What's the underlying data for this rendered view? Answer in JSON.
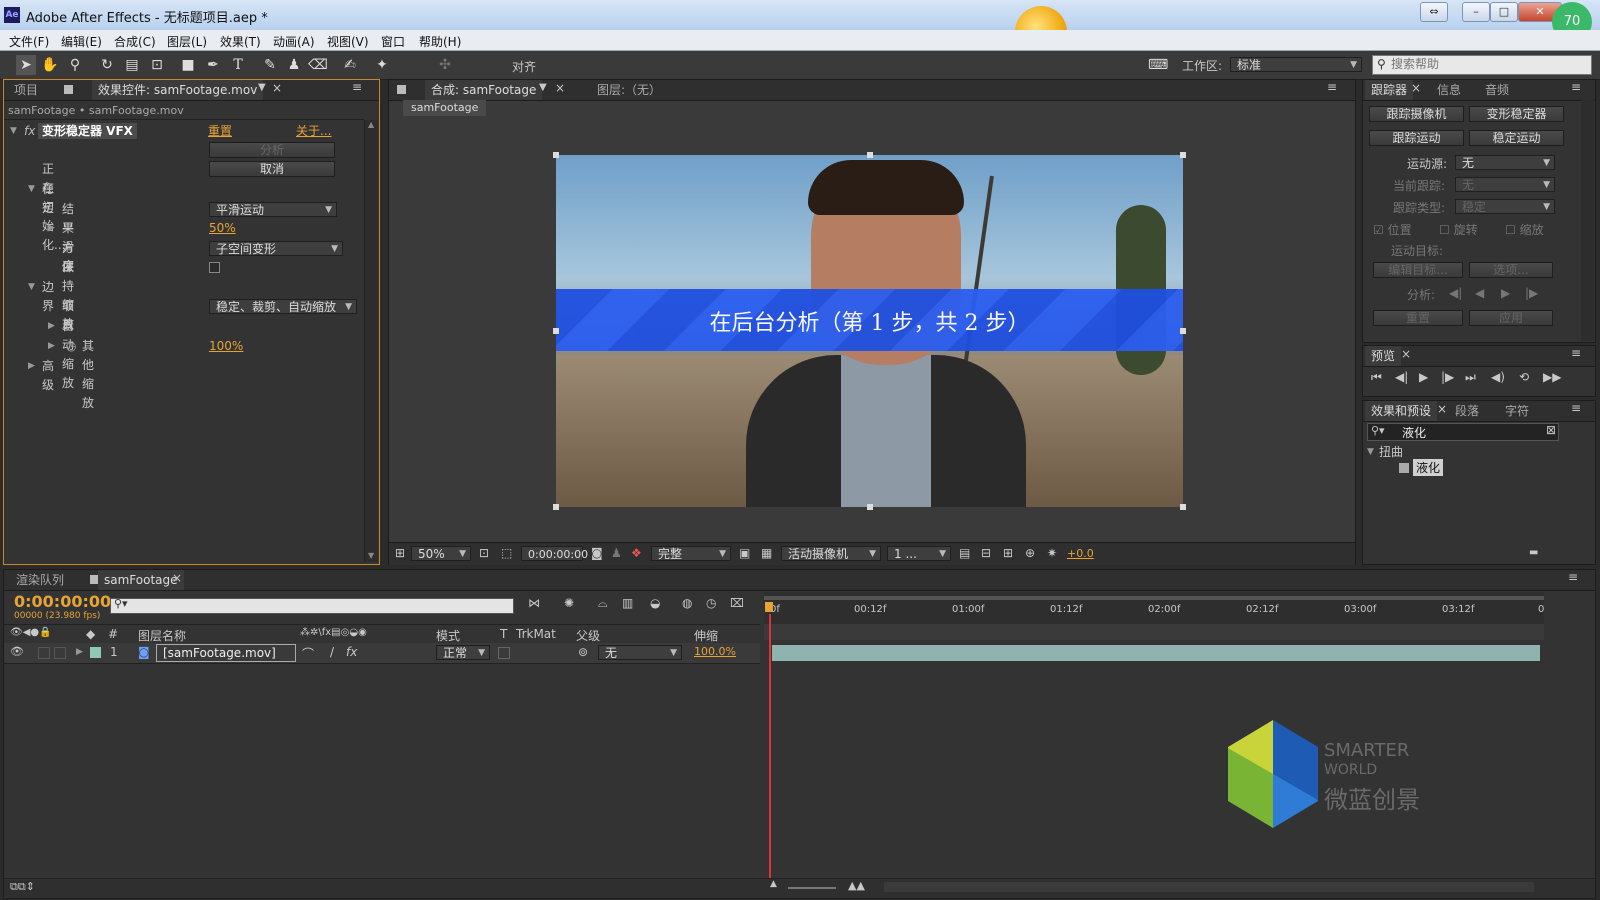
{
  "window": {
    "title": "Adobe After Effects - 无标题项目.aep *",
    "logo": "Ae",
    "min": "–",
    "max": "□",
    "close": "✕",
    "extra": "⇔"
  },
  "menu": [
    "文件(F)",
    "编辑(E)",
    "合成(C)",
    "图层(L)",
    "效果(T)",
    "动画(A)",
    "视图(V)",
    "窗口",
    "帮助(H)"
  ],
  "toolbar": {
    "align_label": "对齐",
    "workspace_label": "工作区:",
    "workspace_value": "标准",
    "search_placeholder": "搜索帮助"
  },
  "left_panel": {
    "tabs": [
      "项目",
      "效果控件: samFootage.mov"
    ],
    "path": "samFootage • samFootage.mov",
    "effect_name": "变形稳定器 VFX",
    "reset": "重置",
    "about": "关于...",
    "analyze_btn": "分析",
    "initializing": "正在初始化...",
    "cancel_btn": "取消",
    "stabilize": "稳定",
    "result_label": "结果",
    "result_value": "平滑运动",
    "smoothness_label": "平滑度",
    "smoothness_value": "50%",
    "method_label": "方法",
    "method_value": "子空间变形",
    "keep_scale_label": "保持缩放",
    "borders": "边界",
    "framing_label": "取景",
    "framing_value": "稳定、裁剪、自动缩放",
    "auto_scale_label": "自动缩放",
    "other_scale_label": "其他缩放",
    "other_scale_value": "100%",
    "advanced": "高级"
  },
  "comp_panel": {
    "tab": "合成: samFootage",
    "layer_tab": "图层:（无）",
    "comp_chip": "samFootage",
    "banner": "在后台分析（第 1 步，共 2 步）",
    "zoom": "50%",
    "timecode": "0:00:00:00",
    "resolution": "完整",
    "camera": "活动摄像机",
    "views": "1 ...",
    "exposure": "+0.0"
  },
  "right_panel": {
    "tracker_tabs": [
      "跟踪器",
      "信息",
      "音频"
    ],
    "track_camera": "跟踪摄像机",
    "warp_stabilizer": "变形稳定器",
    "track_motion": "跟踪运动",
    "stabilize_motion": "稳定运动",
    "motion_source_label": "运动源:",
    "motion_source_value": "无",
    "current_track_label": "当前跟踪:",
    "current_track_value": "无",
    "track_type_label": "跟踪类型:",
    "track_type_value": "稳定",
    "position": "位置",
    "rotation": "旋转",
    "scale": "缩放",
    "motion_target": "运动目标:",
    "edit_target": "编辑目标...",
    "options": "选项...",
    "analyze": "分析:",
    "reset": "重置",
    "apply": "应用",
    "preview_tab": "预览",
    "effects_tabs": [
      "效果和预设",
      "段落",
      "字符"
    ],
    "effects_search": "液化",
    "category": "扭曲",
    "effect_item": "液化"
  },
  "timeline": {
    "tabs": [
      "渲染队列",
      "samFootage"
    ],
    "timecode": "0:00:00:00",
    "fps": "00000 (23.980 fps)",
    "col_num": "#",
    "col_name": "图层名称",
    "col_mode": "模式",
    "col_t": "T",
    "col_trkmat": "TrkMat",
    "col_parent": "父级",
    "col_stretch": "伸缩",
    "layer_num": "1",
    "layer_name": "[samFootage.mov]",
    "layer_mode": "正常",
    "layer_parent": "无",
    "layer_stretch": "100.0%",
    "ruler": [
      "0f",
      "00:12f",
      "01:00f",
      "01:12f",
      "02:00f",
      "02:12f",
      "03:00f",
      "03:12f",
      "0"
    ]
  },
  "watermark": {
    "line1": "SMARTER",
    "line2": "WORLD",
    "line3": "微蓝创景"
  },
  "badge": "70",
  "colors": {
    "accent_orange": "#e8a336",
    "banner_blue": "#1f4fe0",
    "timeline_bar": "#8fb4b0"
  }
}
